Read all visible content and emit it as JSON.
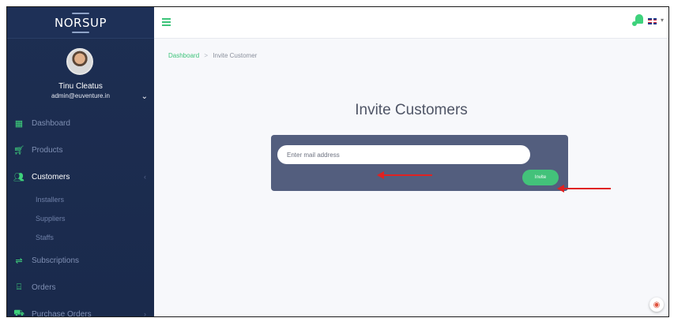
{
  "brand": {
    "name": "NORSUP"
  },
  "profile": {
    "name": "Tinu Cleatus",
    "email": "admin@euventure.in",
    "toggle_icon": "chevron-down-icon"
  },
  "sidebar": {
    "items": [
      {
        "label": "Dashboard",
        "icon": "dashboard-icon"
      },
      {
        "label": "Products",
        "icon": "cart-icon"
      },
      {
        "label": "Customers",
        "icon": "users-icon",
        "active": true,
        "sub_items": [
          {
            "label": "Installers"
          },
          {
            "label": "Suppliers"
          },
          {
            "label": "Staffs"
          }
        ]
      },
      {
        "label": "Subscriptions",
        "icon": "subscriptions-icon"
      },
      {
        "label": "Orders",
        "icon": "orders-icon"
      },
      {
        "label": "Purchase Orders",
        "icon": "purchase-orders-icon"
      }
    ]
  },
  "topbar": {
    "menu_icon": "hamburger-icon",
    "notification_icon": "bell-icon",
    "language_icon": "uk-flag-icon"
  },
  "breadcrumb": {
    "home": "Dashboard",
    "separator": ">",
    "current": "Invite Customer"
  },
  "page": {
    "title": "Invite Customers"
  },
  "invite_form": {
    "email_placeholder": "Enter mail address",
    "email_value": "",
    "button_label": "Invite"
  },
  "colors": {
    "sidebar_bg": "#1d2e52",
    "accent": "#3ec47a",
    "card_bg": "#535e7e",
    "annotation_arrow": "#e02222"
  }
}
